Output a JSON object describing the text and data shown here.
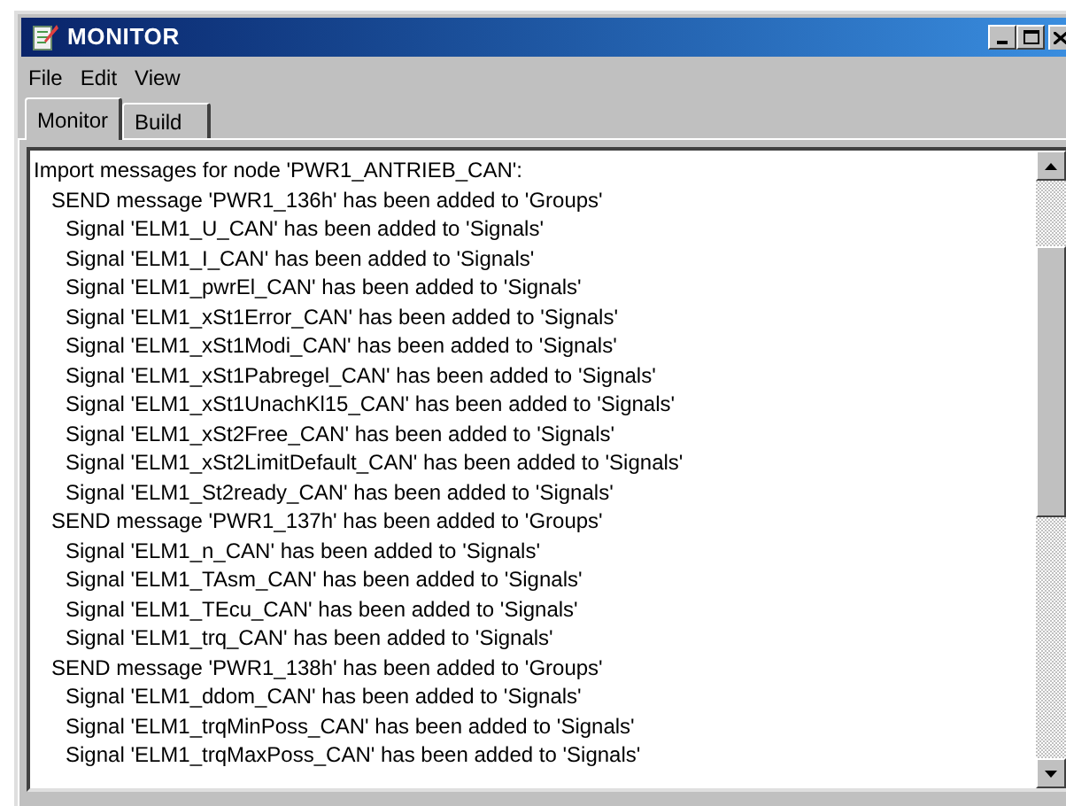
{
  "window": {
    "title": "MONITOR"
  },
  "menu": [
    "File",
    "Edit",
    "View"
  ],
  "tabs": [
    {
      "label": "Monitor",
      "selected": true
    },
    {
      "label": "Build",
      "selected": false
    }
  ],
  "log": {
    "text": "Import messages for node 'PWR1_ANTRIEB_CAN':",
    "children": [
      {
        "text": "SEND message 'PWR1_136h' has been added to 'Groups'",
        "children": [
          {
            "text": "Signal 'ELM1_U_CAN' has been added to 'Signals'"
          },
          {
            "text": "Signal 'ELM1_I_CAN' has been added to 'Signals'"
          },
          {
            "text": "Signal 'ELM1_pwrEl_CAN' has been added to 'Signals'"
          },
          {
            "text": "Signal 'ELM1_xSt1Error_CAN' has been added to 'Signals'"
          },
          {
            "text": "Signal 'ELM1_xSt1Modi_CAN' has been added to 'Signals'"
          },
          {
            "text": "Signal 'ELM1_xSt1Pabregel_CAN' has been added to 'Signals'"
          },
          {
            "text": "Signal 'ELM1_xSt1UnachKl15_CAN' has been added to 'Signals'"
          },
          {
            "text": "Signal 'ELM1_xSt2Free_CAN' has been added to 'Signals'"
          },
          {
            "text": "Signal 'ELM1_xSt2LimitDefault_CAN' has been added to 'Signals'"
          },
          {
            "text": "Signal 'ELM1_St2ready_CAN' has been added to 'Signals'"
          }
        ]
      },
      {
        "text": "SEND message 'PWR1_137h' has been added to 'Groups'",
        "children": [
          {
            "text": "Signal 'ELM1_n_CAN' has been added to 'Signals'"
          },
          {
            "text": "Signal 'ELM1_TAsm_CAN' has been added to 'Signals'"
          },
          {
            "text": "Signal 'ELM1_TEcu_CAN' has been added to 'Signals'"
          },
          {
            "text": "Signal 'ELM1_trq_CAN' has been added to 'Signals'"
          }
        ]
      },
      {
        "text": "SEND message 'PWR1_138h' has been added to 'Groups'",
        "children": [
          {
            "text": "Signal 'ELM1_ddom_CAN' has been added to 'Signals'"
          },
          {
            "text": "Signal 'ELM1_trqMinPoss_CAN' has been added to 'Signals'"
          },
          {
            "text": "Signal 'ELM1_trqMaxPoss_CAN' has been added to 'Signals'"
          }
        ]
      }
    ]
  }
}
